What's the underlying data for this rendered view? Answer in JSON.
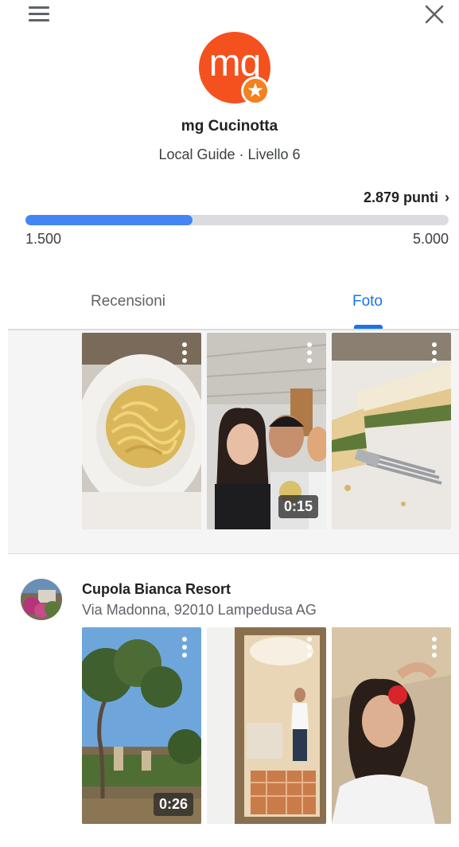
{
  "header": {
    "menu_icon": "hamburger-menu-icon",
    "close_icon": "close-icon"
  },
  "profile": {
    "initials": "mq",
    "avatar_color": "#f4511e",
    "badge_color": "#f4801f",
    "name": "mg Cucinotta",
    "level": "Local Guide · Livello 6"
  },
  "progress": {
    "points_label": "2.879 punti",
    "chevron": "›",
    "min_label": "1.500",
    "max_label": "5.000",
    "fraction": 0.394,
    "fill_color": "#4285f4"
  },
  "tabs": {
    "reviews": "Recensioni",
    "photos": "Foto",
    "active": "photos",
    "accent": "#1a73e8"
  },
  "group1": {
    "photos": [
      {
        "description": "pasta-dish",
        "duration": ""
      },
      {
        "description": "selfie-group",
        "duration": "0:15"
      },
      {
        "description": "pie-slice",
        "duration": ""
      }
    ]
  },
  "group2": {
    "place_name": "Cupola Bianca Resort",
    "place_address": "Via Madonna, 92010 Lampedusa AG",
    "photos": [
      {
        "description": "olive-tree-garden",
        "duration": "0:26"
      },
      {
        "description": "mirror-selfie",
        "duration": ""
      },
      {
        "description": "portrait-with-flower",
        "duration": ""
      }
    ]
  }
}
